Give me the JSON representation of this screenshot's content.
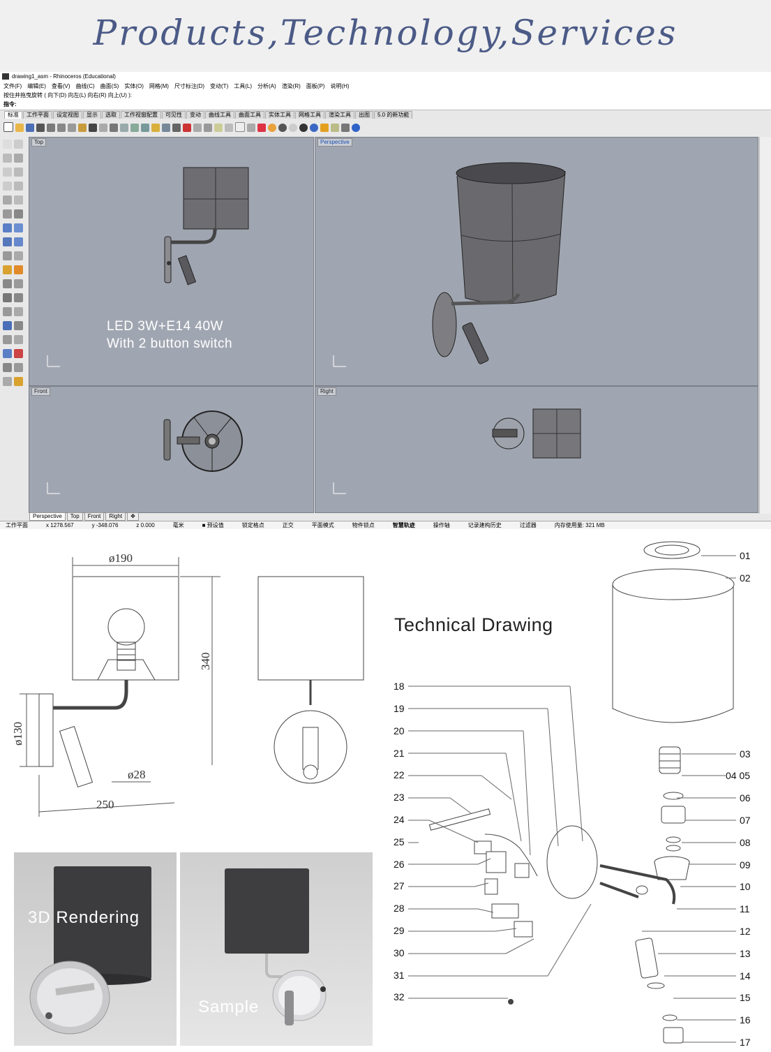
{
  "banner": {
    "title": "Products,Technology,Services"
  },
  "window": {
    "title": "drawing1_asm - Rhinoceros (Educational)",
    "menus": [
      "文件(F)",
      "编辑(E)",
      "查看(V)",
      "曲线(C)",
      "曲面(S)",
      "实体(O)",
      "网格(M)",
      "尺寸标注(D)",
      "变动(T)",
      "工具(L)",
      "分析(A)",
      "渲染(R)",
      "面板(P)",
      "说明(H)"
    ],
    "hint": "按住并拖曳旋转 ( 向下(D)  向左(L)  向右(R)  向上(U) ):",
    "command_label": "指令:",
    "tabs": [
      "标准",
      "工作平面",
      "设定视图",
      "显示",
      "选取",
      "工作视窗配置",
      "可见性",
      "变动",
      "曲线工具",
      "曲面工具",
      "实体工具",
      "网格工具",
      "渲染工具",
      "出图",
      "5.0 的新功能"
    ],
    "active_tab": "标准",
    "viewports": {
      "top": {
        "label": "Top"
      },
      "perspective": {
        "label": "Perspective"
      },
      "front": {
        "label": "Front"
      },
      "right": {
        "label": "Right"
      }
    },
    "overlay_text": {
      "line1": "LED 3W+E14 40W",
      "line2": "With 2 button switch"
    },
    "bottom_tabs": [
      "Perspective",
      "Top",
      "Front",
      "Right",
      "✥"
    ],
    "status": [
      "工作平面",
      "x 1278.567",
      "y -348.076",
      "z 0.000",
      "毫米",
      "■ 预设值",
      "锁定格点",
      "正交",
      "平面模式",
      "物件锁点",
      "智慧轨迹",
      "操作轴",
      "记录建构历史",
      "过滤器",
      "内存使用量: 321 MB"
    ]
  },
  "technical": {
    "title": "Technical Drawing",
    "dims": {
      "width": "ø190",
      "height": "340",
      "backplate": "ø130",
      "spot": "ø28",
      "depth": "250"
    },
    "parts_right": [
      "01",
      "02",
      "03",
      "04 05",
      "06",
      "07",
      "08",
      "09",
      "10",
      "11",
      "12",
      "13",
      "14",
      "15",
      "16",
      "17"
    ],
    "parts_left": [
      "18",
      "19",
      "20",
      "21",
      "22",
      "23",
      "24",
      "25",
      "26",
      "27",
      "28",
      "29",
      "30",
      "31",
      "32"
    ]
  },
  "renders": {
    "left_caption": "3D Rendering",
    "right_caption": "Sample"
  },
  "colors": {
    "banner_text": "#4b5a86",
    "viewport_bg": "#a0a6b1",
    "shade_dark": "#3e3e40"
  }
}
